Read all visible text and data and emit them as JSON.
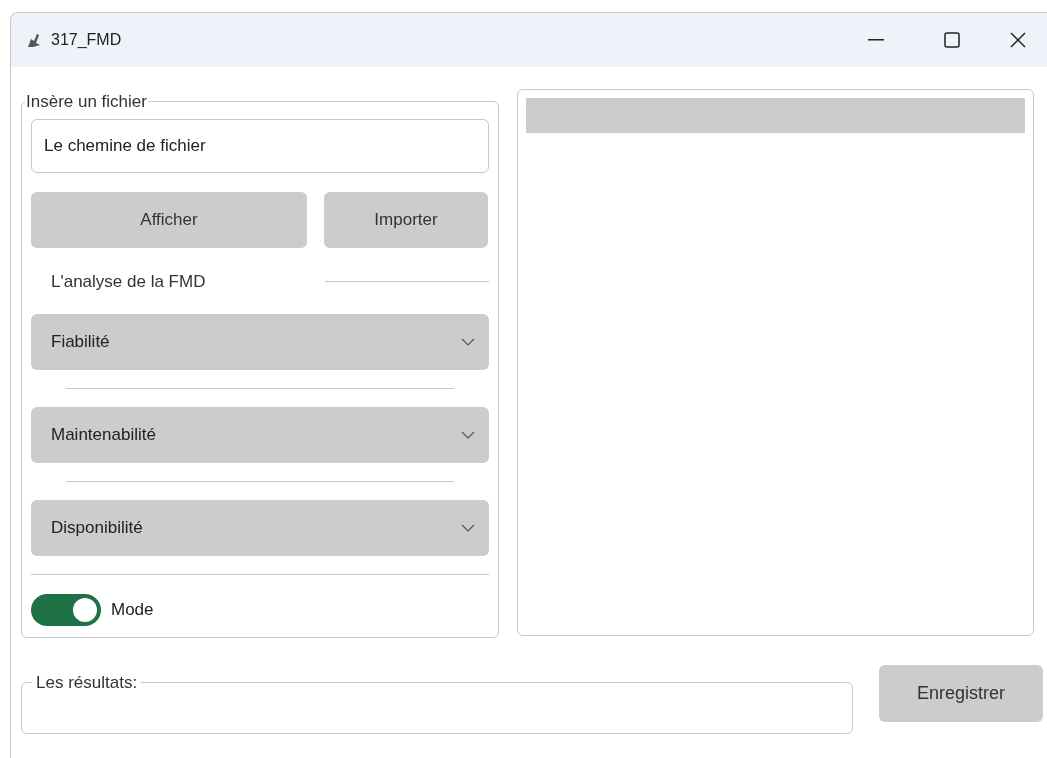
{
  "window": {
    "title": "317_FMD"
  },
  "file_group": {
    "legend": "Insère un fichier",
    "path_field": {
      "value": "Le chemine de fichier"
    },
    "buttons": [
      "Afficher",
      "Importer"
    ]
  },
  "analysis": {
    "heading": "L'analyse de la FMD",
    "dropdowns": [
      {
        "label": "Fiabilité"
      },
      {
        "label": "Maintenabilité"
      },
      {
        "label": "Disponibilité"
      }
    ]
  },
  "mode_switch": {
    "label": "Mode",
    "on": true
  },
  "results": {
    "legend": "Les résultats:"
  },
  "save_button": "Enregistrer"
}
